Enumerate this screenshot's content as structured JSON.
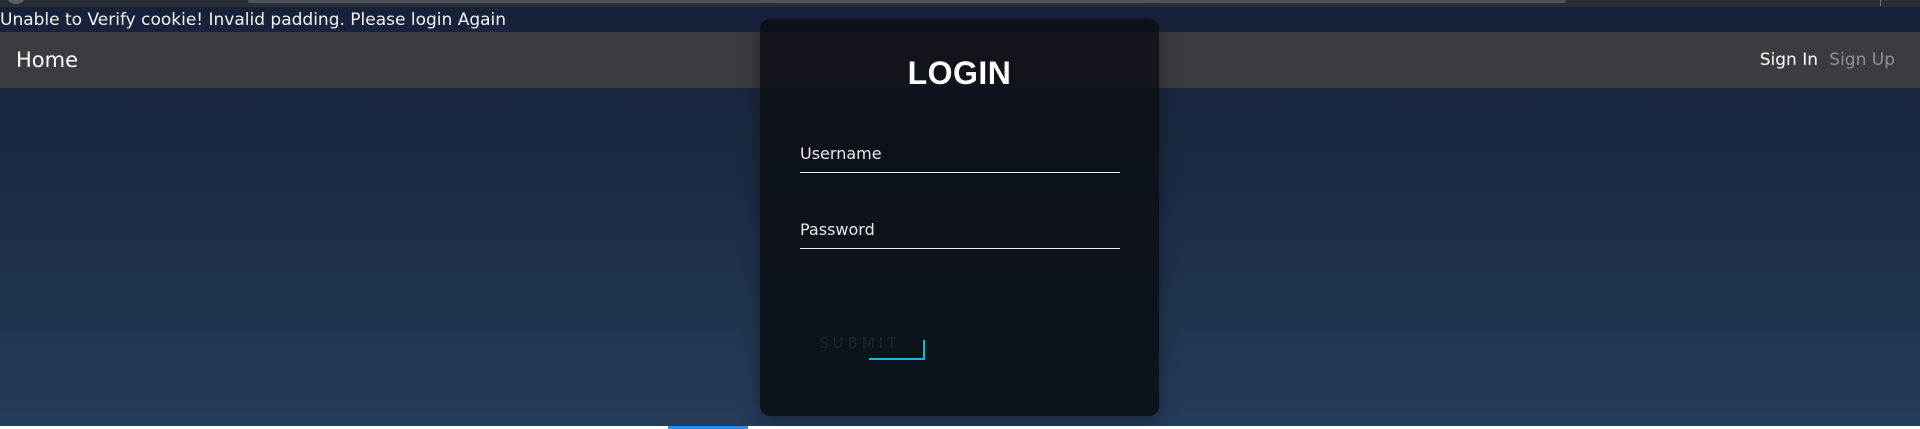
{
  "message": {
    "text": "Unable to Verify cookie! Invalid padding. Please login Again"
  },
  "navbar": {
    "home_label": "Home",
    "sign_in_label": "Sign In",
    "sign_up_label": "Sign Up"
  },
  "login": {
    "title": "LOGIN",
    "username": {
      "value": "",
      "placeholder": "Username"
    },
    "password": {
      "value": "",
      "placeholder": "Password"
    },
    "submit_label": "SUBMIT"
  },
  "colors": {
    "navbar_bg": "#393c40",
    "card_bg": "#0a0e14",
    "accent": "#19b8d4",
    "indicator": "#2b8ee8"
  }
}
